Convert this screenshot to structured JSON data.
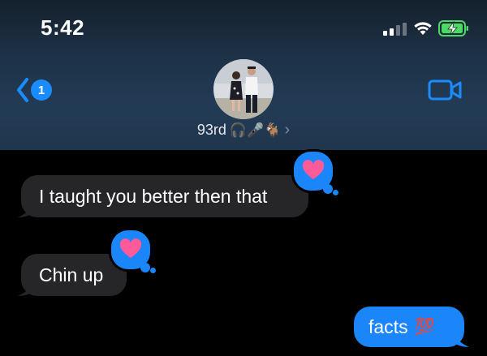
{
  "status_bar": {
    "time": "5:42"
  },
  "header": {
    "back_badge": "1",
    "contact_name": "93rd",
    "contact_emojis": "🎧🎤🐐",
    "chevron": "›"
  },
  "messages": [
    {
      "direction": "incoming",
      "text": "I taught you better then that",
      "reaction": "heart"
    },
    {
      "direction": "incoming",
      "text": "Chin up",
      "reaction": "heart"
    },
    {
      "direction": "outgoing",
      "text": "facts",
      "emoji": "💯"
    }
  ],
  "colors": {
    "imessage_blue": "#1b86f9",
    "incoming_bubble": "#262629",
    "heart_pink": "#ff5a9a",
    "background": "#000000"
  },
  "icons": [
    "signal-icon",
    "wifi-icon",
    "battery-charging-icon",
    "back-chevron-icon",
    "video-call-icon",
    "heart-icon"
  ]
}
